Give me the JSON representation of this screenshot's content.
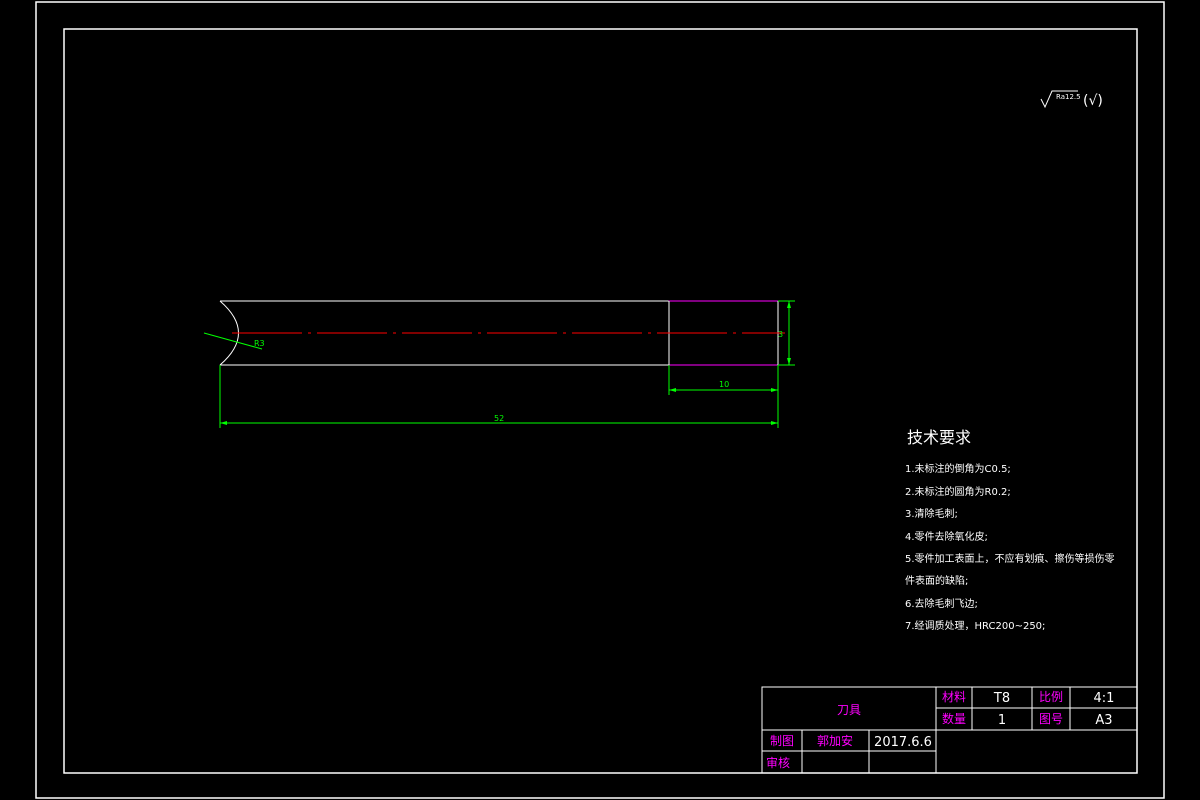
{
  "roughness": {
    "value": "Ra12.5",
    "paren": "(√)"
  },
  "dimensions": {
    "radius": "R3",
    "diameter": "3",
    "length_end": "10",
    "length_total": "52"
  },
  "tech_requirements": {
    "title": "技术要求",
    "items": [
      "1.未标注的倒角为C0.5;",
      "2.未标注的圆角为R0.2;",
      "3.清除毛刺;",
      "4.零件去除氧化皮;",
      "5.零件加工表面上，不应有划痕、擦伤等损伤零",
      "件表面的缺陷;",
      "6.去除毛刺飞边;",
      "7.经调质处理，HRC200~250;"
    ]
  },
  "title_block": {
    "part_name": "刀具",
    "material_label": "材料",
    "material_value": "T8",
    "scale_label": "比例",
    "scale_value": "4:1",
    "qty_label": "数量",
    "qty_value": "1",
    "drawing_no_label": "图号",
    "drawing_no_value": "A3",
    "drawn_label": "制图",
    "drawn_name": "郭加安",
    "drawn_date": "2017.6.6",
    "check_label": "审核"
  },
  "colors": {
    "background": "#000000",
    "border": "#ffffff",
    "dimension": "#00ff00",
    "centerline": "#ff0000",
    "hidden_part": "#ff00ff",
    "label": "#ff00ff",
    "text": "#ffffff"
  }
}
